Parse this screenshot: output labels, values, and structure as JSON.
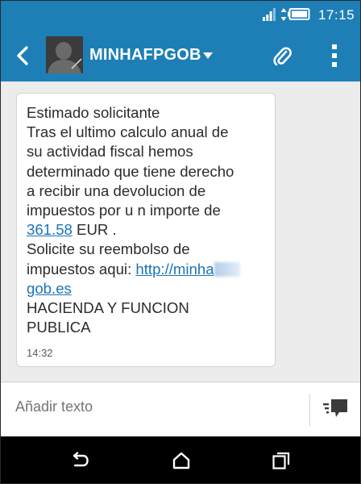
{
  "status_bar": {
    "time": "17:15"
  },
  "app_bar": {
    "contact_name": "MINHAFPGOB"
  },
  "message": {
    "line_1": "Estimado solicitante",
    "line_2": "Tras el ultimo calculo anual de",
    "line_3": "su actividad fiscal hemos",
    "line_4": "determinado que tiene derecho",
    "line_5": "a recibir una devolucion de",
    "line_6": "impuestos por u n importe de",
    "amount": "361.58",
    "currency": " EUR .",
    "line_8": "Solicite su reembolso de",
    "line_9_prefix": "impuestos aqui: ",
    "link_part_1": "http://minha",
    "link_part_2": "gob.es",
    "line_11": "HACIENDA Y FUNCION",
    "line_12": "PUBLICA",
    "time": "14:32"
  },
  "composer": {
    "placeholder": "Añadir texto"
  },
  "icons": {
    "back": "back-arrow-icon",
    "dropdown": "chevron-down-icon",
    "attach": "paperclip-icon",
    "more": "more-vertical-icon",
    "send": "send-message-icon",
    "nav_back": "nav-back-icon",
    "nav_home": "nav-home-icon",
    "nav_recent": "nav-recent-apps-icon"
  },
  "colors": {
    "header": "#1d7fb6",
    "link": "#1a73b8",
    "conversation_bg": "#ececec",
    "nav_bar": "#000000"
  }
}
